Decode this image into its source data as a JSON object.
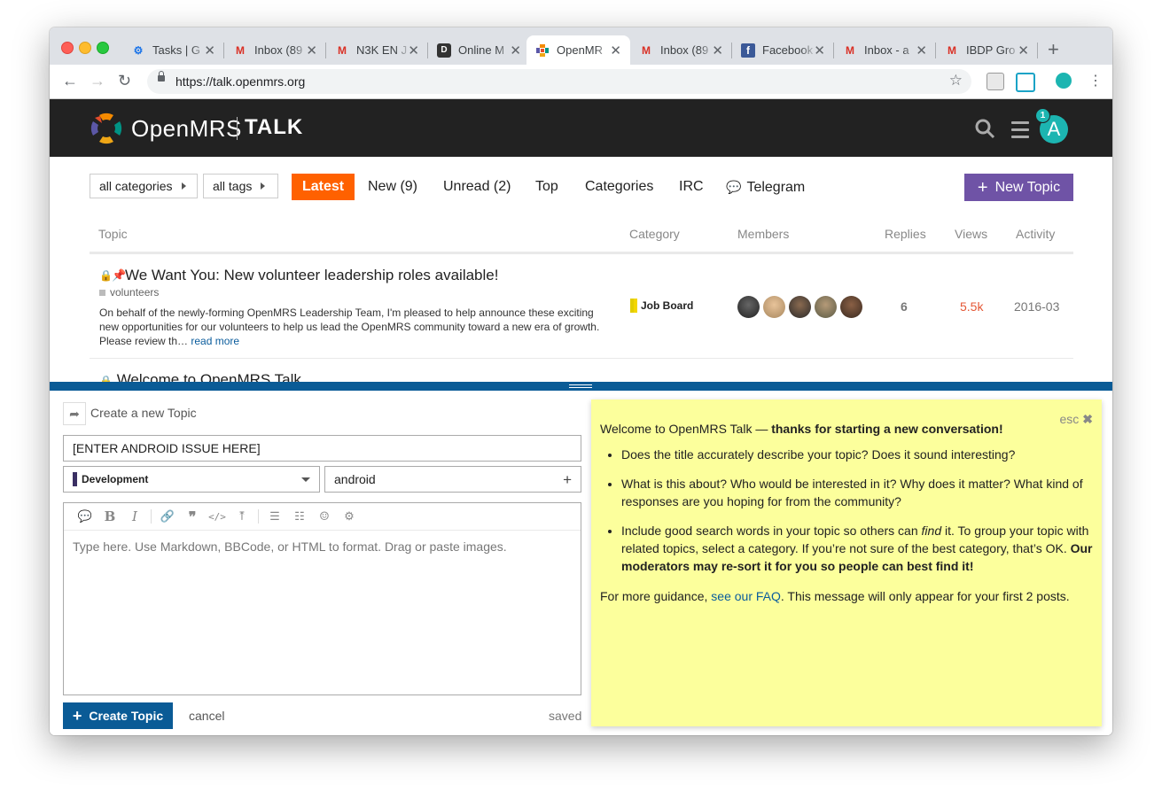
{
  "browser": {
    "tabs": [
      {
        "label": "Tasks | G",
        "icon": "gear-icon",
        "icon_color": "#1a73e8"
      },
      {
        "label": "Inbox (89",
        "icon": "gmail-icon",
        "icon_color": "#d93025"
      },
      {
        "label": "N3K EN J",
        "icon": "gmail-icon",
        "icon_color": "#d93025"
      },
      {
        "label": "Online M",
        "icon": "d-icon",
        "icon_color": "#444444"
      },
      {
        "label": "OpenMR",
        "icon": "openmrs-icon",
        "icon_color": "#f48a00"
      },
      {
        "label": "Inbox (89",
        "icon": "gmail-icon",
        "icon_color": "#d93025"
      },
      {
        "label": "Facebook",
        "icon": "facebook-icon",
        "icon_color": "#3b5998"
      },
      {
        "label": "Inbox - a",
        "icon": "gmail-icon",
        "icon_color": "#d93025"
      },
      {
        "label": "IBDP Gro",
        "icon": "gmail-icon",
        "icon_color": "#d93025"
      }
    ],
    "url": "https://talk.openmrs.org"
  },
  "header": {
    "brand": "OpenMRS",
    "brand_suffix": "TALK",
    "notification_count": "1",
    "avatar_letter": "A"
  },
  "nav": {
    "filter_categories": "all categories",
    "filter_tags": "all tags",
    "items": [
      "Latest",
      "New (9)",
      "Unread (2)",
      "Top",
      "Categories",
      "IRC",
      "Telegram"
    ],
    "new_topic_label": "New Topic",
    "accent": "#ff6100",
    "new_topic_color": "#6f53a6"
  },
  "table": {
    "columns": [
      "Topic",
      "Category",
      "Members",
      "Replies",
      "Views",
      "Activity"
    ],
    "rows": [
      {
        "title": "We Want You: New volunteer leadership roles available!",
        "tag": "volunteers",
        "excerpt": "On behalf of the newly-forming OpenMRS Leadership Team, I'm pleased to help announce these exciting new opportunities for our volunteers to help us lead the OpenMRS community toward a new era of growth. Please review th…",
        "read_more": "read more",
        "category": "Job Board",
        "replies": "6",
        "views": "5.5k",
        "activity": "2016-03"
      },
      {
        "title": "Welcome to OpenMRS Talk"
      }
    ]
  },
  "composer": {
    "action_title": "Create a new Topic",
    "title_value": "[ENTER ANDROID ISSUE HERE]",
    "category": "Development",
    "tag": "android",
    "editor_placeholder": "Type here. Use Markdown, BBCode, or HTML to format. Drag or paste images.",
    "create_label": "Create Topic",
    "cancel_label": "cancel",
    "status": "saved",
    "accent": "#0a5b96"
  },
  "help": {
    "esc": "esc",
    "intro_plain": "Welcome to OpenMRS Talk — ",
    "intro_bold": "thanks for starting a new conversation!",
    "bullet1": "Does the title accurately describe your topic? Does it sound interesting?",
    "bullet2": "What is this about? Who would be interested in it? Why does it matter? What kind of responses are you hoping for from the community?",
    "bullet3_a": "Include good search words in your topic so others can ",
    "bullet3_em": "find",
    "bullet3_b": " it. To group your topic with related topics, select a category. If you’re not sure of the best category, that’s OK. ",
    "bullet3_bold": "Our moderators may re-sort it for you so people can best find it!",
    "foot_a": "For more guidance, ",
    "foot_link": "see our FAQ",
    "foot_b": ". This message will only appear for your first 2 posts.",
    "background": "#fcff9c"
  }
}
